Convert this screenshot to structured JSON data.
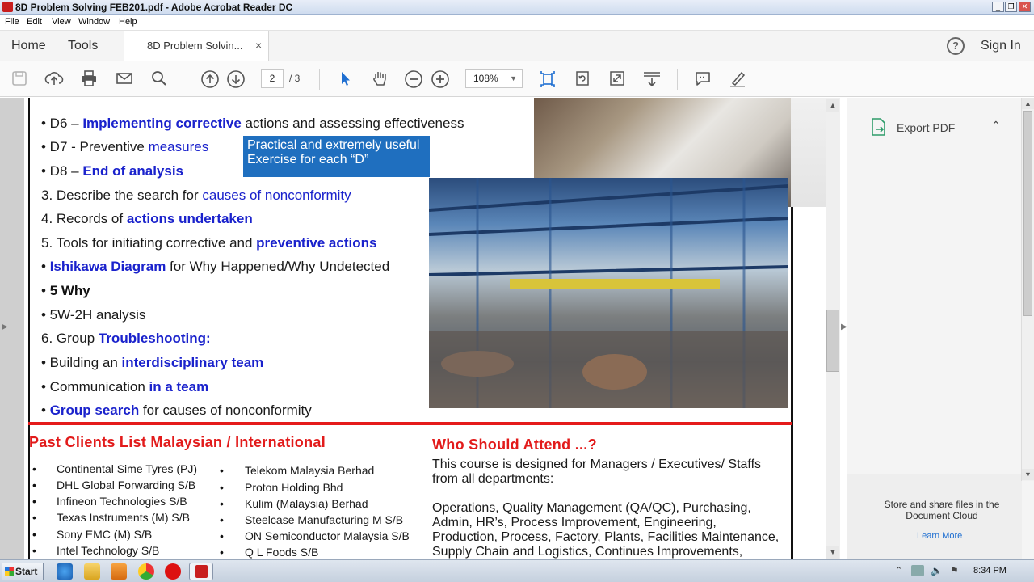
{
  "window": {
    "title": "8D Problem Solving FEB201.pdf - Adobe Acrobat Reader DC",
    "min": "_",
    "max": "❐",
    "close": "✕"
  },
  "menu": [
    "File",
    "Edit",
    "View",
    "Window",
    "Help"
  ],
  "tabs": {
    "home": "Home",
    "tools": "Tools",
    "doc": "8D Problem Solvin...",
    "close": "×",
    "help": "?",
    "signin": "Sign In"
  },
  "toolbar": {
    "page_current": "2",
    "page_total": "/ 3",
    "zoom": "108%"
  },
  "document": {
    "box_text": "Practical and extremely useful Exercise for each “D”",
    "lines": [
      {
        "pre": "• D6 – ",
        "blue": "Implementing corrective",
        "post": " actions and assessing effectiveness"
      },
      {
        "pre": "• D7 - Preventive ",
        "blue": "measures",
        "post": ""
      },
      {
        "pre": "• D8 – ",
        "blue": "End of analysis",
        "post": ""
      },
      {
        "pre": "3. Describe the search for ",
        "blue": "causes of nonconformity",
        "post": ""
      },
      {
        "pre": "4. Records of ",
        "blue": "actions undertaken",
        "post": ""
      },
      {
        "pre": "5. Tools for initiating corrective and ",
        "blue": "preventive actions",
        "post": ""
      },
      {
        "pre": "• ",
        "blue": "Ishikawa Diagram",
        "post": " for Why Happened/Why Undetected"
      },
      {
        "pre": "• ",
        "blue": "5 Why",
        "post": ""
      },
      {
        "pre": "• 5W-2H analysis",
        "blue": "",
        "post": ""
      },
      {
        "pre": "6. Group ",
        "blue": "Troubleshooting:",
        "post": ""
      },
      {
        "pre": "• Building an ",
        "blue": "interdisciplinary team",
        "post": ""
      },
      {
        "pre": "• Communication ",
        "blue": "in a team",
        "post": ""
      },
      {
        "pre": "• ",
        "blue": "Group search",
        "post": " for causes of nonconformity"
      }
    ],
    "clients_title": "Past Clients List Malaysian / International",
    "clients_left": [
      "Continental Sime Tyres (PJ)",
      "DHL Global Forwarding S/B",
      "Infineon Technologies S/B",
      "Texas Instruments (M) S/B",
      "Sony EMC (M) S/B",
      "Intel Technology S/B"
    ],
    "clients_right": [
      "Telekom Malaysia Berhad",
      "Proton Holding Bhd",
      "Kulim (Malaysia) Berhad",
      "Steelcase Manufacturing M S/B",
      "ON Semiconductor Malaysia S/B",
      "Q L Foods S/B"
    ],
    "attend_title": "Who Should Attend ...?",
    "attend_intro": "This course is designed for Managers / Executives/ Staffs from all departments:",
    "attend_body": "Operations, Quality Management (QA/QC), Purchasing, Admin, HR’s, Process Improvement, Engineering, Production, Process, Factory, Plants, Facilities Maintenance, Supply Chain and Logistics, Continues Improvements,"
  },
  "rightpane": {
    "export": "Export PDF",
    "cloud": "Store and share files in the Document Cloud",
    "learn": "Learn More"
  },
  "taskbar": {
    "start": "Start",
    "clock": "8:34 PM"
  }
}
